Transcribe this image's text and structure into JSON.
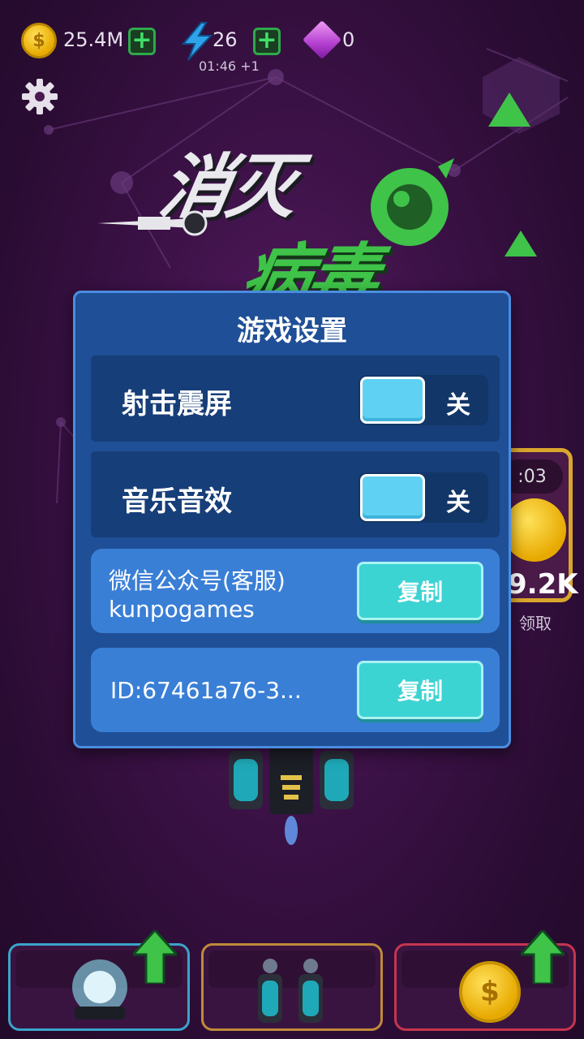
{
  "hud": {
    "coins": "25.4M",
    "energy": "26",
    "energy_timer": "01:46 +1",
    "gems": "0"
  },
  "title": {
    "line1": "消灭",
    "line2": "病毒"
  },
  "side_card": {
    "timer": ":03",
    "value": "9.2K",
    "label": "领取"
  },
  "dialog": {
    "title": "游戏设置",
    "settings": [
      {
        "label": "射击震屏",
        "state": "关"
      },
      {
        "label": "音乐音效",
        "state": "关"
      }
    ],
    "wechat_label": "微信公众号(客服)",
    "wechat_id": "kunpogames",
    "user_id": "ID:67461a76-3...",
    "copy_label": "复制"
  },
  "colors": {
    "dialog_bg": "#1f4f96",
    "toggle_knob": "#5fd1f3",
    "copy_button": "#3cd3d3",
    "coin": "#f2c21b",
    "green_accent": "#3fc349"
  },
  "icons": [
    "coin-icon",
    "lightning-icon",
    "plus-icon",
    "gem-icon",
    "gear-icon",
    "up-arrow-icon"
  ]
}
